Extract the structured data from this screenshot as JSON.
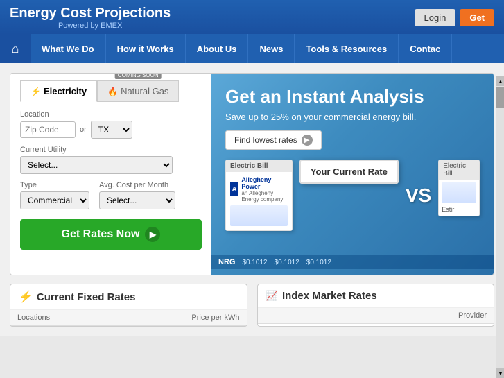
{
  "header": {
    "title": "Energy Cost Projections",
    "subtitle": "Powered by EMEX",
    "login_label": "Login",
    "get_label": "Get"
  },
  "nav": {
    "home_icon": "⌂",
    "items": [
      {
        "label": "What We Do",
        "id": "what-we-do"
      },
      {
        "label": "How it Works",
        "id": "how-it-works"
      },
      {
        "label": "About Us",
        "id": "about-us"
      },
      {
        "label": "News",
        "id": "news"
      },
      {
        "label": "Tools & Resources",
        "id": "tools-resources"
      },
      {
        "label": "Contac",
        "id": "contact"
      }
    ]
  },
  "form": {
    "tab_electricity": "Electricity",
    "tab_natural_gas": "Natural Gas",
    "coming_soon": "COMING SOON",
    "location_label": "Location",
    "zip_placeholder": "Zip Code",
    "or_text": "or",
    "state_value": "TX",
    "utility_label": "Current Utility",
    "utility_placeholder": "Select...",
    "type_label": "Type",
    "type_value": "Commercial",
    "avg_cost_label": "Avg. Cost per Month",
    "avg_cost_placeholder": "Select...",
    "get_rates_label": "Get Rates Now",
    "lightning_icon": "⚡",
    "flame_icon": "🔥"
  },
  "banner": {
    "title": "Get an Instant Analysis",
    "subtitle": "Save up to 25% on your commercial energy bill.",
    "find_rates_label": "Find lowest rates",
    "bill_header": "Electric Bill",
    "bill_header2": "Electric Bill",
    "allegheny_label": "Allegheny Power",
    "allegheny_sub": "an Allegheny Energy company",
    "your_rate_label": "Your Current Rate",
    "vs_label": "VS",
    "est_label": "Estir",
    "nrg_label": "NRG",
    "price1": "$0.1012",
    "price2": "$0.1012",
    "price3": "$0.1012"
  },
  "bottom": {
    "fixed_rates_icon": "⚡",
    "fixed_rates_label": "Current Fixed Rates",
    "index_rates_icon": "📈",
    "index_rates_label": "Index Market Rates",
    "col_locations": "Locations",
    "col_price_kwh": "Price per kWh",
    "col_provider": "Provider"
  }
}
